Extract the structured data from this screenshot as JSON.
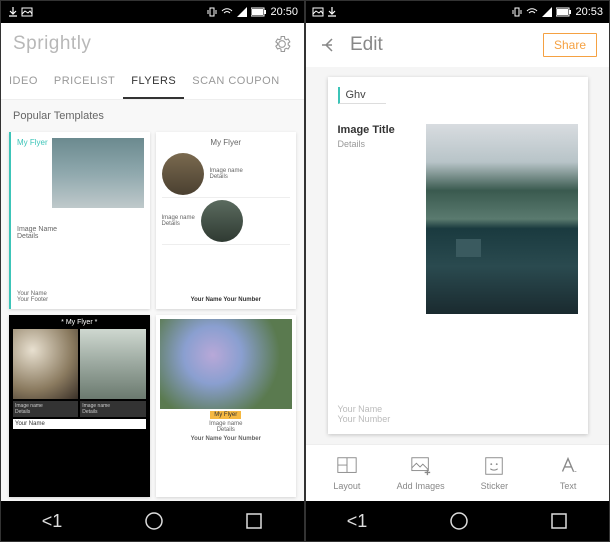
{
  "left": {
    "status": {
      "time": "20:50"
    },
    "app_title": "Sprightly",
    "tabs": {
      "t1": "IDEO",
      "t2": "PRICELIST",
      "t3": "FLYERS",
      "t4": "SCAN COUPON"
    },
    "section": "Popular Templates",
    "card1": {
      "label": "My Flyer",
      "info1": "Image Name",
      "info2": "Details",
      "foot1": "Your Name",
      "foot2": "Your Footer"
    },
    "card2": {
      "title": "My Flyer",
      "info1": "Image name",
      "info2": "Details",
      "info3": "Image name",
      "info4": "Details",
      "footer": "Your Name   Your Number"
    },
    "card3": {
      "title": "* My Flyer *",
      "info1": "Image name",
      "info2": "Details",
      "info3": "Image name",
      "info4": "Details",
      "footer": "Your Name"
    },
    "card4": {
      "tag": "My Flyer",
      "info1": "Image name",
      "info2": "Details",
      "footer": "Your Name   Your Number"
    },
    "nav_back": "<1"
  },
  "right": {
    "status": {
      "time": "20:53"
    },
    "edit_title": "Edit",
    "share": "Share",
    "canvas": {
      "tag": "Ghv",
      "title": "Image Title",
      "details": "Details",
      "foot1": "Your Name",
      "foot2": "Your Number"
    },
    "tools": {
      "t1": "Layout",
      "t2": "Add Images",
      "t3": "Sticker",
      "t4": "Text"
    },
    "nav_back": "<1"
  }
}
